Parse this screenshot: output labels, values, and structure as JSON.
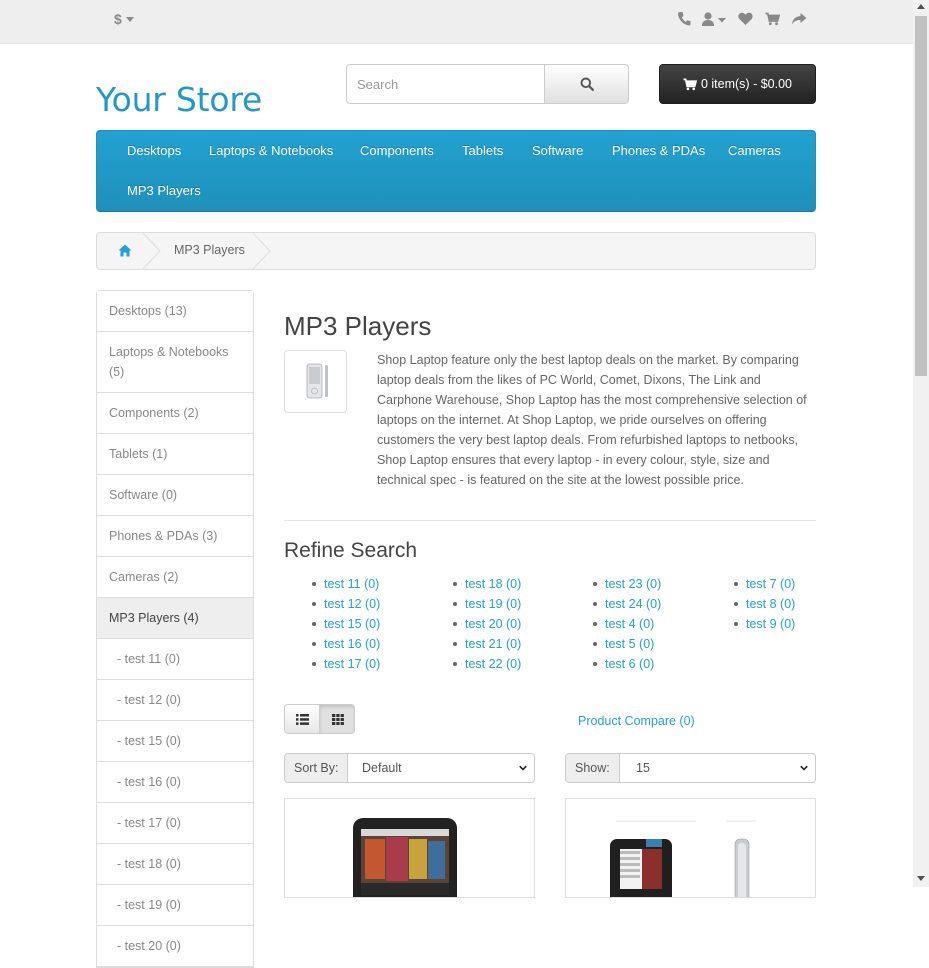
{
  "top_bar": {
    "currency_symbol": "$"
  },
  "header": {
    "logo": "Your Store",
    "search_placeholder": "Search",
    "cart_label": "0 item(s) - $0.00"
  },
  "menu": {
    "items": [
      "Desktops",
      "Laptops & Notebooks",
      "Components",
      "Tablets",
      "Software",
      "Phones & PDAs",
      "Cameras",
      "MP3 Players"
    ]
  },
  "breadcrumb": {
    "current": "MP3 Players"
  },
  "sidebar": {
    "items": [
      {
        "label": "Desktops (13)",
        "active": false
      },
      {
        "label": "Laptops & Notebooks (5)",
        "active": false
      },
      {
        "label": "Components (2)",
        "active": false
      },
      {
        "label": "Tablets (1)",
        "active": false
      },
      {
        "label": "Software (0)",
        "active": false
      },
      {
        "label": "Phones & PDAs (3)",
        "active": false
      },
      {
        "label": "Cameras (2)",
        "active": false
      },
      {
        "label": "MP3 Players (4)",
        "active": true
      },
      {
        "label": "- test 11 (0)",
        "active": false
      },
      {
        "label": "- test 12 (0)",
        "active": false
      },
      {
        "label": "- test 15 (0)",
        "active": false
      },
      {
        "label": "- test 16 (0)",
        "active": false
      },
      {
        "label": "- test 17 (0)",
        "active": false
      },
      {
        "label": "- test 18 (0)",
        "active": false
      },
      {
        "label": "- test 19 (0)",
        "active": false
      },
      {
        "label": "- test 20 (0)",
        "active": false
      }
    ]
  },
  "content": {
    "title": "MP3 Players",
    "description": "Shop Laptop feature only the best laptop deals on the market. By comparing laptop deals from the likes of PC World, Comet, Dixons, The Link and Carphone Warehouse, Shop Laptop has the most comprehensive selection of laptops on the internet. At Shop Laptop, we pride ourselves on offering customers the very best laptop deals. From refurbished laptops to netbooks, Shop Laptop ensures that every laptop - in every colour, style, size and technical spec - is featured on the site at the lowest possible price.",
    "refine_title": "Refine Search",
    "refine_columns": [
      [
        "test 11 (0)",
        "test 12 (0)",
        "test 15 (0)",
        "test 16 (0)",
        "test 17 (0)"
      ],
      [
        "test 18 (0)",
        "test 19 (0)",
        "test 20 (0)",
        "test 21 (0)",
        "test 22 (0)"
      ],
      [
        "test 23 (0)",
        "test 24 (0)",
        "test 4 (0)",
        "test 5 (0)",
        "test 6 (0)"
      ],
      [
        "test 7 (0)",
        "test 8 (0)",
        "test 9 (0)"
      ]
    ],
    "compare_label": "Product Compare (0)",
    "sort_label": "Sort By:",
    "sort_value": "Default",
    "show_label": "Show:",
    "show_value": "15"
  },
  "colors": {
    "accent": "#229ac8",
    "menu_top": "#23a1d1",
    "cart_bg": "#303030"
  },
  "icons": {
    "top_bar": [
      "phone-icon",
      "user-icon",
      "heart-icon",
      "shopping-cart-icon",
      "share-icon"
    ],
    "search": "search-icon",
    "cart": "shopping-cart-icon",
    "breadcrumb": "home-icon",
    "view": [
      "list-icon",
      "grid-icon"
    ]
  }
}
